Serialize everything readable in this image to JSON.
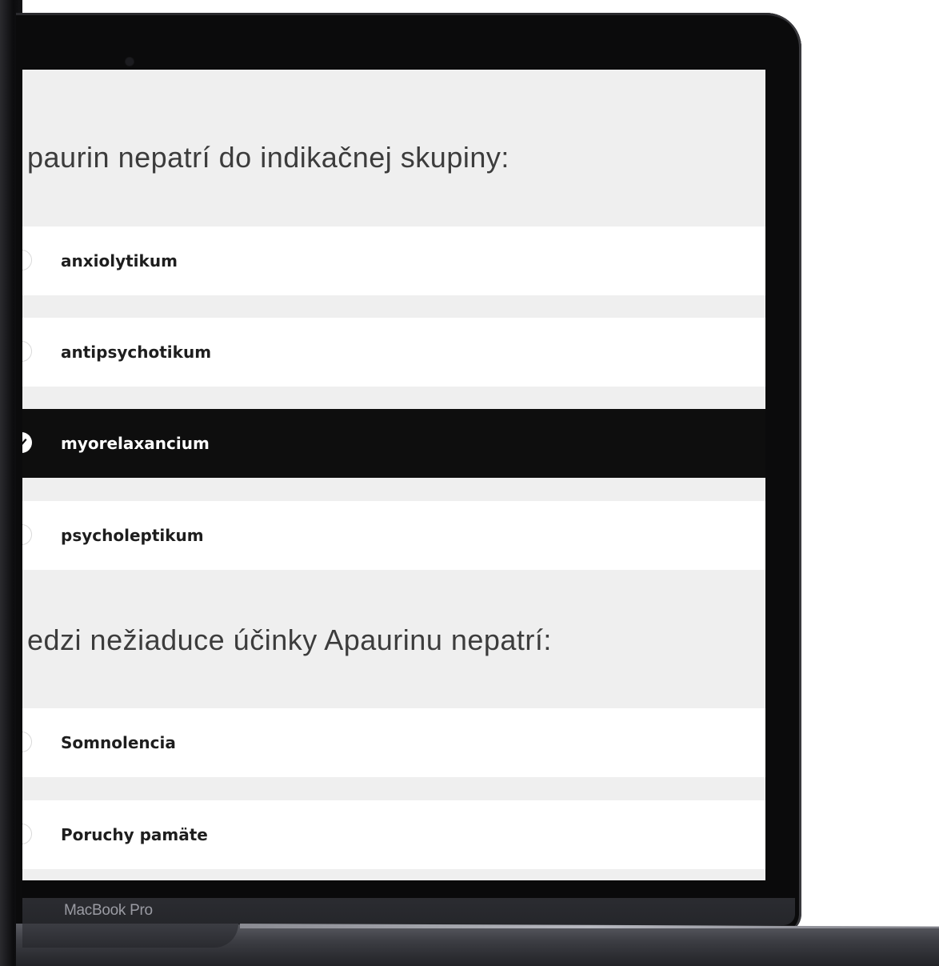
{
  "device": {
    "brand_label": "MacBook Pro"
  },
  "quiz": {
    "question1": {
      "text": "paurin nepatrí do indikačnej skupiny:",
      "options": [
        {
          "label": "anxiolytikum",
          "selected": false
        },
        {
          "label": "antipsychotikum",
          "selected": false
        },
        {
          "label": "myorelaxancium",
          "selected": true
        },
        {
          "label": "psycholeptikum",
          "selected": false
        }
      ]
    },
    "question2": {
      "text": "edzi nežiaduce účinky Apaurinu nepatrí:",
      "options": [
        {
          "label": "Somnolencia",
          "selected": false
        },
        {
          "label": "Poruchy pamäte",
          "selected": false
        }
      ]
    }
  },
  "colors": {
    "selected_bg": "#0e0e0e",
    "screen_bg": "#efefef",
    "option_bg": "#ffffff"
  },
  "icons": {
    "selected_marker": "check-icon",
    "camera": "camera-icon"
  }
}
